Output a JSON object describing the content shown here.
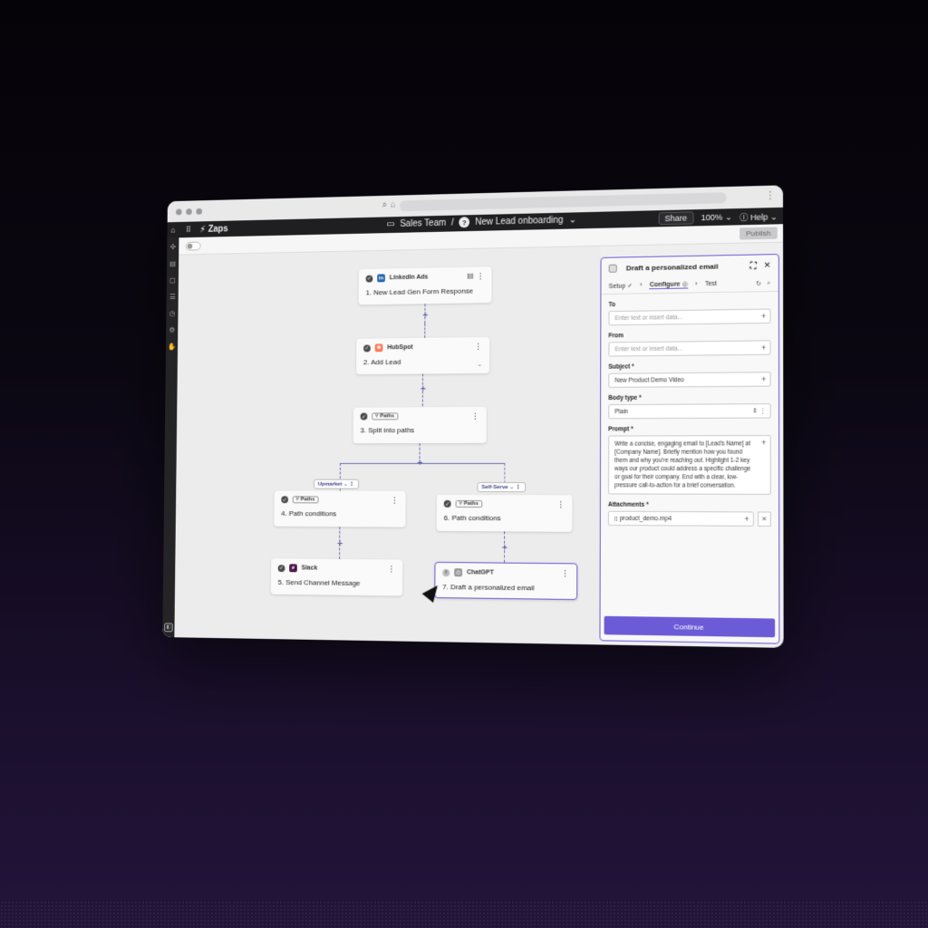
{
  "appbar": {
    "brand": "Zaps",
    "workspace": "Sales Team",
    "separator": "/",
    "zap_name": "New Lead onboarding",
    "share": "Share",
    "zoom": "100%",
    "help": "Help"
  },
  "toolbar": {
    "publish": "Publish"
  },
  "nodes": {
    "n1": {
      "app": "LinkedIn Ads",
      "title": "1. New Lead Gen Form Response"
    },
    "n2": {
      "app": "HubSpot",
      "title": "2. Add Lead"
    },
    "n3": {
      "app": "Paths",
      "title": "3. Split into paths"
    },
    "n4": {
      "app": "Paths",
      "title": "4. Path conditions"
    },
    "n5": {
      "app": "Slack",
      "title": "5. Send Channel Message"
    },
    "n6": {
      "app": "Paths",
      "title": "6. Path conditions"
    },
    "n7": {
      "app": "ChatGPT",
      "title": "7. Draft a personalized email"
    }
  },
  "branches": {
    "left": "Upmarket",
    "right": "Self-Serve"
  },
  "panel": {
    "title": "Draft a personalized email",
    "steps": [
      "Setup",
      "Configure",
      "Test"
    ],
    "to_label": "To",
    "to_placeholder": "Enter text or insert data...",
    "from_label": "From",
    "from_placeholder": "Enter text or insert data...",
    "subject_label": "Subject",
    "subject_value": "New Product Demo Video",
    "body_type_label": "Body type",
    "body_type_value": "Plain",
    "prompt_label": "Prompt",
    "prompt_value": "Write a concise, engaging email to [Lead's Name] at [Company Name]. Briefly mention how you found them and why you're reaching out. Highlight 1-2 key ways our product could address a specific challenge or goal for their company. End with a clear, low-pressure call-to-action for a brief conversation.",
    "attachments_label": "Attachments",
    "attachment_file": "product_demo.mp4",
    "continue": "Continue"
  },
  "colors": {
    "accent": "#6b5bd6",
    "sidebar": "#242427"
  }
}
